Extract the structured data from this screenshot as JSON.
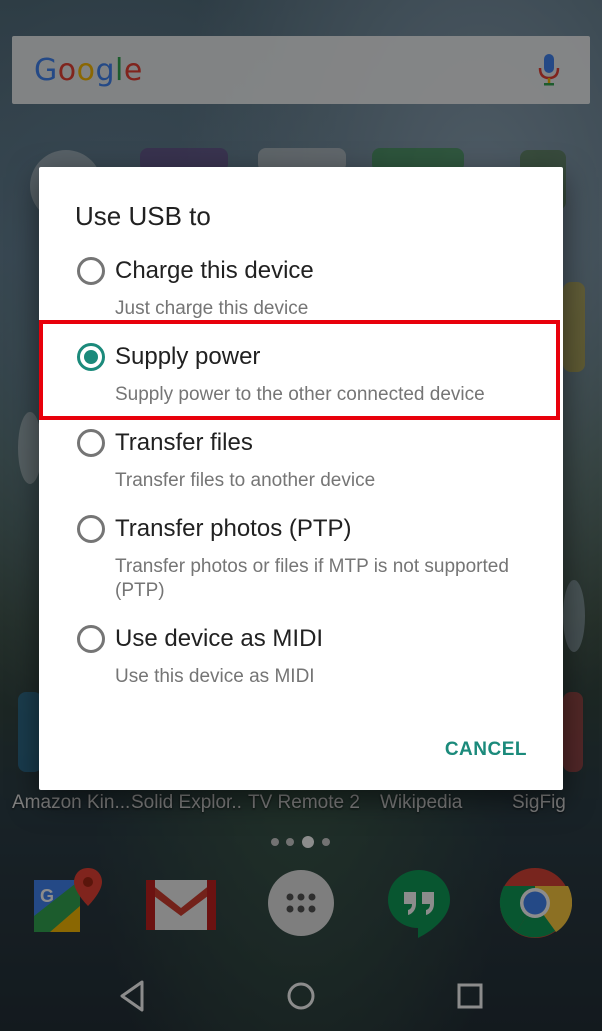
{
  "search": {
    "brand": "Google"
  },
  "dialog": {
    "title": "Use USB to",
    "options": [
      {
        "label": "Charge this device",
        "description": "Just charge this device",
        "selected": false
      },
      {
        "label": "Supply power",
        "description": "Supply power to the other connected device",
        "selected": true
      },
      {
        "label": "Transfer files",
        "description": "Transfer files to another device",
        "selected": false
      },
      {
        "label": "Transfer photos (PTP)",
        "description": "Transfer photos or files if MTP is not supported (PTP)",
        "selected": false
      },
      {
        "label": "Use device as MIDI",
        "description": "Use this device as MIDI",
        "selected": false
      }
    ],
    "cancel_label": "CANCEL"
  },
  "home_apps": [
    {
      "label": "Amazon Kin..."
    },
    {
      "label": "Solid Explor.."
    },
    {
      "label": "TV Remote 2"
    },
    {
      "label": "Wikipedia"
    },
    {
      "label": "SigFig"
    }
  ],
  "dock": [
    "google-maps-icon",
    "gmail-icon",
    "app-drawer-icon",
    "hangouts-icon",
    "chrome-icon"
  ],
  "navbar": [
    "back-icon",
    "home-icon",
    "recents-icon"
  ],
  "colors": {
    "accent": "#1b8a7b",
    "highlight": "#e8000b"
  }
}
